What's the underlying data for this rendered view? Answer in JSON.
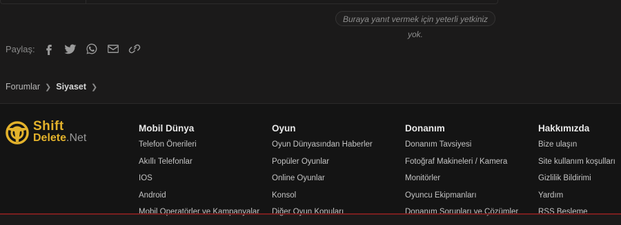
{
  "post_area": {
    "no_permission": "Buraya yanıt vermek için yeterli yetkiniz yok."
  },
  "share": {
    "label": "Paylaş:",
    "icons": [
      "facebook-icon",
      "twitter-icon",
      "whatsapp-icon",
      "email-icon",
      "link-icon"
    ]
  },
  "breadcrumb": {
    "items": [
      "Forumlar",
      "Siyaset"
    ]
  },
  "footer": {
    "logo": {
      "line1": "Shift",
      "line2a": "Delete",
      "line2b": ".Net"
    },
    "columns": [
      {
        "title": "Mobil Dünya",
        "links": [
          "Telefon Önerileri",
          "Akıllı Telefonlar",
          "IOS",
          "Android",
          "Mobil Operatörler ve Kampanyalar"
        ]
      },
      {
        "title": "Oyun",
        "links": [
          "Oyun Dünyasından Haberler",
          "Popüler Oyunlar",
          "Online Oyunlar",
          "Konsol",
          "Diğer Oyun Konuları"
        ]
      },
      {
        "title": "Donanım",
        "links": [
          "Donanım Tavsiyesi",
          "Fotoğraf Makineleri / Kamera",
          "Monitörler",
          "Oyuncu Ekipmanları",
          "Donanım Sorunları ve Çözümler"
        ]
      },
      {
        "title": "Hakkımızda",
        "links": [
          "Bize ulaşın",
          "Site kullanım koşulları",
          "Gizlilik Bildirimi",
          "Yardım",
          "RSS Besleme"
        ]
      }
    ]
  },
  "colors": {
    "background": "#1b1a1a",
    "footer_bg": "#141414",
    "brand": "#e3b22b"
  }
}
